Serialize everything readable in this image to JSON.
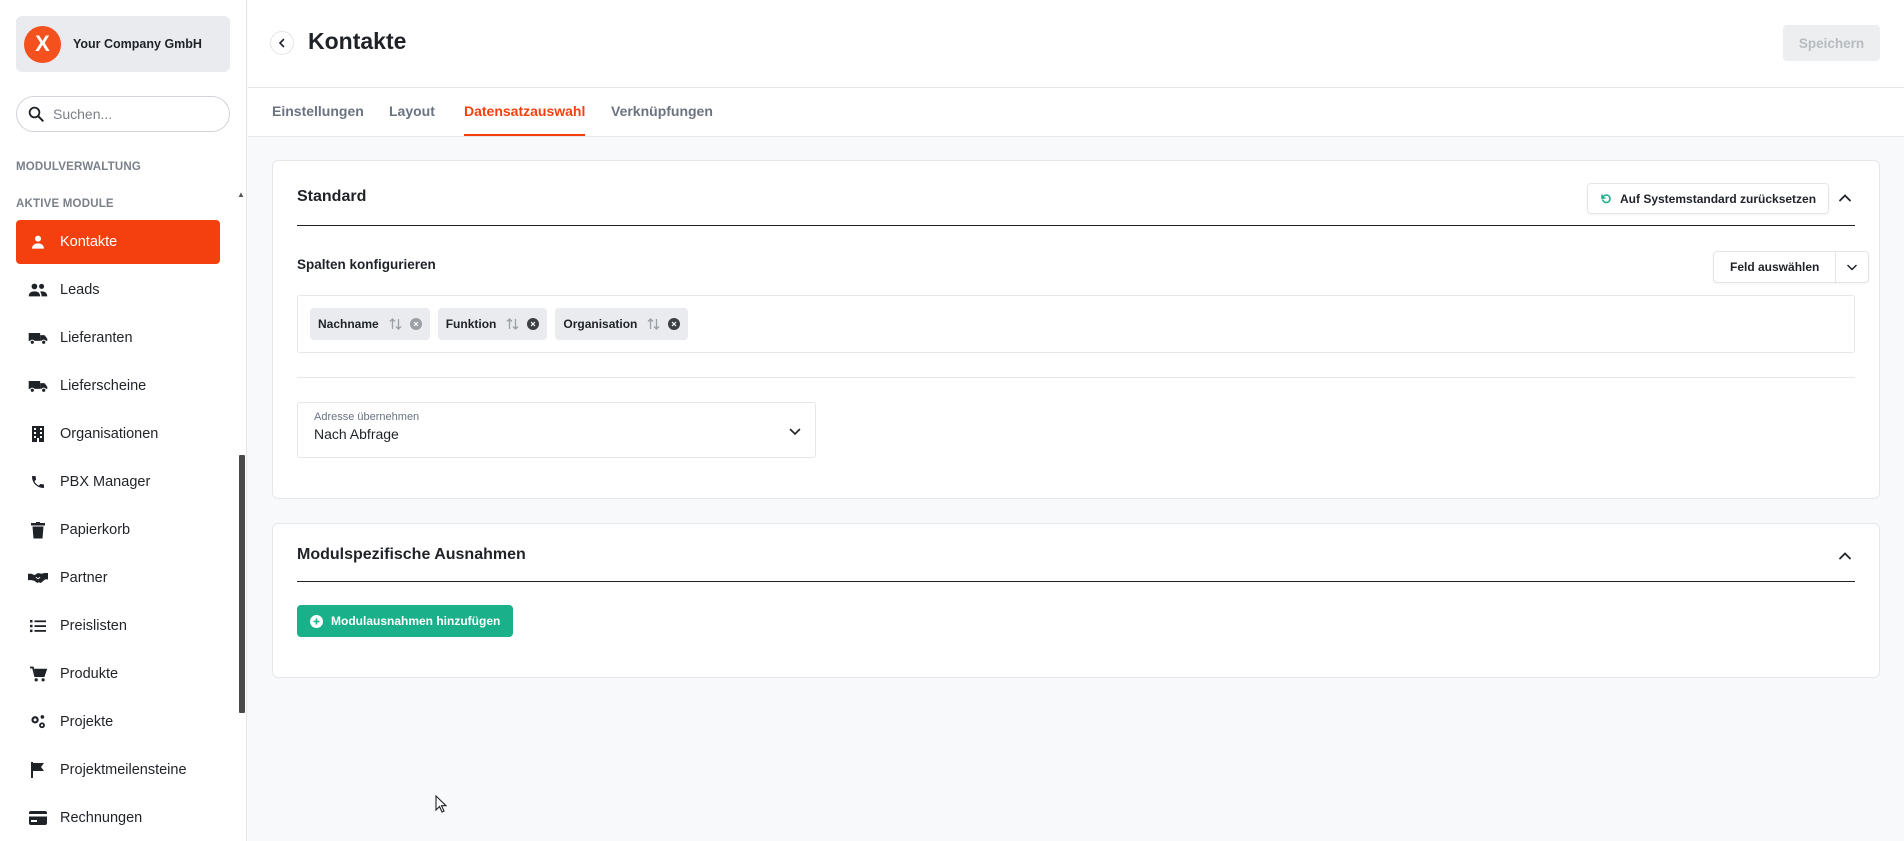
{
  "sidebar": {
    "company_name": "Your Company GmbH",
    "logo_glyph": "X",
    "search_placeholder": "Suchen...",
    "section_management": "MODULVERWALTUNG",
    "section_active": "AKTIVE MODULE",
    "items": [
      {
        "label": "Kontakte",
        "icon": "person-icon",
        "active": true
      },
      {
        "label": "Leads",
        "icon": "people-icon"
      },
      {
        "label": "Lieferanten",
        "icon": "truck-icon"
      },
      {
        "label": "Lieferscheine",
        "icon": "truck-icon"
      },
      {
        "label": "Organisationen",
        "icon": "building-icon"
      },
      {
        "label": "PBX Manager",
        "icon": "phone-icon"
      },
      {
        "label": "Papierkorb",
        "icon": "trash-icon"
      },
      {
        "label": "Partner",
        "icon": "handshake-icon"
      },
      {
        "label": "Preislisten",
        "icon": "list-icon"
      },
      {
        "label": "Produkte",
        "icon": "cart-icon"
      },
      {
        "label": "Projekte",
        "icon": "gears-icon"
      },
      {
        "label": "Projektmeilensteine",
        "icon": "flag-icon"
      },
      {
        "label": "Rechnungen",
        "icon": "credit-card-icon"
      }
    ]
  },
  "header": {
    "title": "Kontakte",
    "save_label": "Speichern"
  },
  "tabs": [
    {
      "label": "Einstellungen"
    },
    {
      "label": "Layout"
    },
    {
      "label": "Datensatzauswahl",
      "active": true
    },
    {
      "label": "Verknüpfungen"
    }
  ],
  "standard": {
    "title": "Standard",
    "reset_label": "Auf Systemstandard zurücksetzen",
    "columns_title": "Spalten konfigurieren",
    "field_select_label": "Feld auswählen",
    "chips": [
      {
        "label": "Nachname"
      },
      {
        "label": "Funktion"
      },
      {
        "label": "Organisation"
      }
    ],
    "address_label": "Adresse übernehmen",
    "address_value": "Nach Abfrage"
  },
  "exceptions": {
    "title": "Modulspezifische Ausnahmen",
    "add_label": "Modulausnahmen hinzufügen"
  },
  "colors": {
    "accent": "#f4400f",
    "success": "#19b08a"
  }
}
